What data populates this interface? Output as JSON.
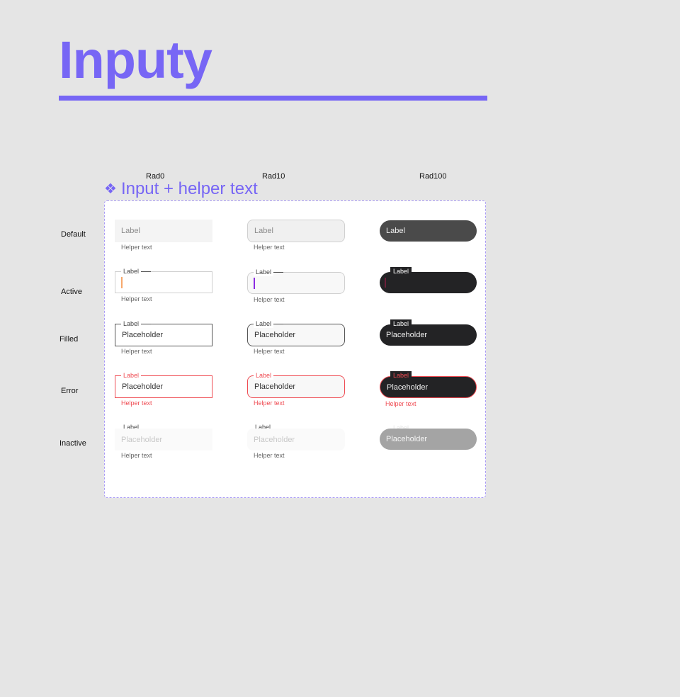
{
  "page": {
    "title": "Inputy"
  },
  "columns": [
    "Rad0",
    "Rad10",
    "Rad100"
  ],
  "rows": [
    "Default",
    "Active",
    "Filled",
    "Error",
    "Inactive"
  ],
  "component": {
    "icon": "component-diamond-icon",
    "glyph": "❖",
    "title": "Input + helper text"
  },
  "field": {
    "label": "Label",
    "placeholder": "Placeholder",
    "helper": "Helper text"
  },
  "colors": {
    "accent": "#7766f5",
    "error": "#ef4b52",
    "dark": "#232325",
    "dark_default": "#4a4a4a",
    "inactive_dark": "#a4a4a4"
  }
}
